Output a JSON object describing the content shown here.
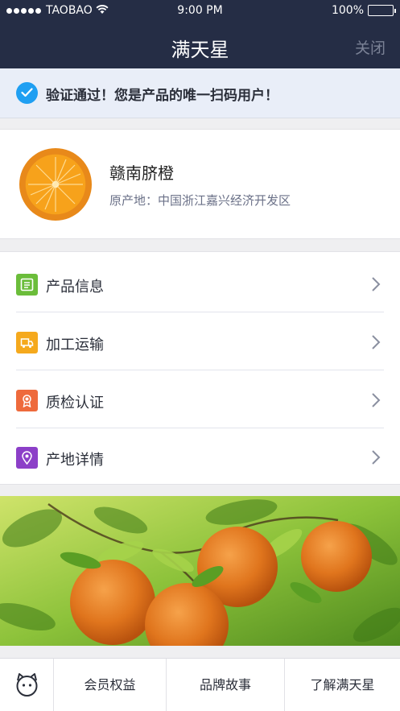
{
  "status_bar": {
    "carrier": "TAOBAO",
    "time": "9:00 PM",
    "battery": "100%"
  },
  "nav": {
    "title": "满天星",
    "close_label": "关闭"
  },
  "verification": {
    "message": "验证通过！您是产品的唯一扫码用户！"
  },
  "product": {
    "name": "赣南脐橙",
    "origin": "原产地：中国浙江嘉兴经济开发区"
  },
  "menu": {
    "items": [
      {
        "label": "产品信息",
        "icon": "product-info-icon",
        "color": "#6bbd3a"
      },
      {
        "label": "加工运输",
        "icon": "truck-icon",
        "color": "#f5a91d"
      },
      {
        "label": "质检认证",
        "icon": "award-icon",
        "color": "#ee6a3c"
      },
      {
        "label": "产地详情",
        "icon": "location-pin-icon",
        "color": "#8c3fc8"
      }
    ]
  },
  "tabbar": {
    "tabs": [
      "会员权益",
      "品牌故事",
      "了解满天星"
    ]
  },
  "colors": {
    "nav_bg": "#252d45",
    "check_blue": "#1f9ff2",
    "banner_bg": "#e9eef8"
  }
}
